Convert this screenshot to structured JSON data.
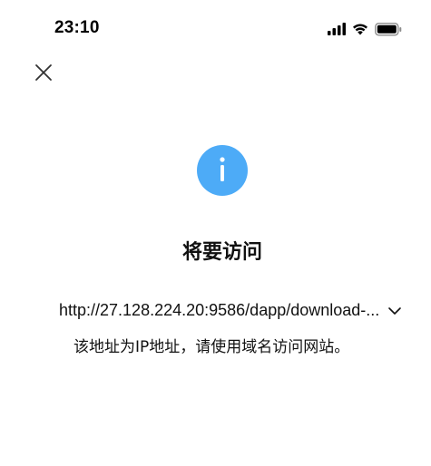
{
  "status_bar": {
    "time": "23:10",
    "icons": [
      "cellular-signal-icon",
      "wifi-icon",
      "battery-icon"
    ]
  },
  "dialog": {
    "close_icon": "close-icon",
    "info_icon": "info-icon",
    "info_glyph": "i",
    "title": "将要访问",
    "url": "http://27.128.224.20:9586/dapp/download-...",
    "expand_icon": "chevron-down-icon",
    "warning": "该地址为IP地址，请使用域名访问网站。"
  },
  "colors": {
    "accent": "#4DABF7",
    "text": "#111111",
    "background": "#ffffff"
  }
}
